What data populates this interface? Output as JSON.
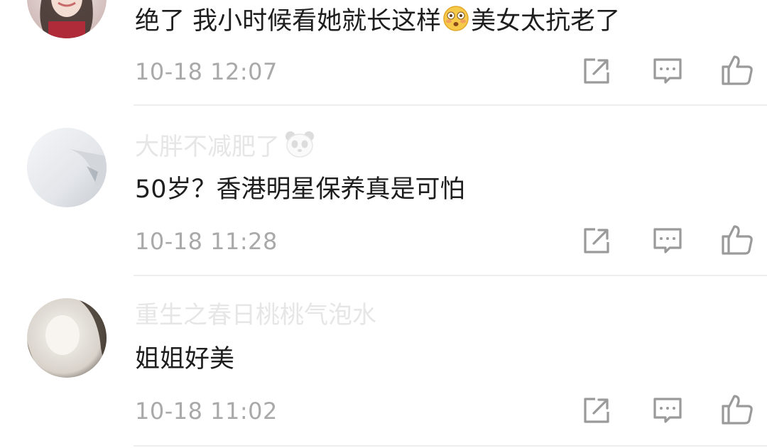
{
  "comments": [
    {
      "username": "",
      "text_before": "绝了 我小时候看她就长这样",
      "emoji": "flushed-face-emoji",
      "text_after": "美女太抗老了",
      "time": "10-18 12:07"
    },
    {
      "username": "大胖不减肥了",
      "username_emoji": "panda-emoji",
      "text": "50岁？香港明星保养真是可怕",
      "time": "10-18 11:28"
    },
    {
      "username": "重生之春日桃桃气泡水",
      "text": "姐姐好美",
      "time": "10-18 11:02"
    }
  ],
  "icons": {
    "forward": "share-box-icon",
    "reply": "comment-bubble-icon",
    "like": "thumbs-up-icon"
  },
  "colors": {
    "text": "#1e1e1e",
    "username": "#e6e6e6",
    "time": "#a9a9a9",
    "icon": "#9a9a9a",
    "divider": "#eeeeee"
  }
}
